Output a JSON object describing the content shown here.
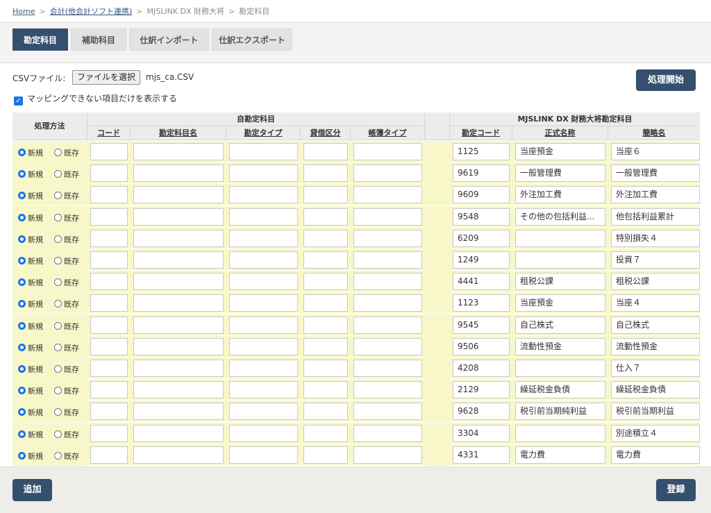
{
  "breadcrumb": {
    "home": "Home",
    "accounting": "会計(他会計ソフト連携)",
    "product": "MJSLINK DX 財務大将",
    "current": "勘定科目"
  },
  "tabs": [
    {
      "label": "勘定科目",
      "active": true
    },
    {
      "label": "補助科目",
      "active": false
    },
    {
      "label": "仕訳インポート",
      "active": false
    },
    {
      "label": "仕訳エクスポート",
      "active": false
    }
  ],
  "csv": {
    "label": "CSVファイル:",
    "choose_button": "ファイルを選択",
    "file_name": "mjs_ca.CSV"
  },
  "start_button": "処理開始",
  "filter_checkbox": {
    "label": "マッピングできない項目だけを表示する",
    "checked": true
  },
  "table": {
    "method_header": "処理方法",
    "own_group_header": "自勘定科目",
    "own_columns": [
      "コード",
      "勘定科目名",
      "勘定タイプ",
      "貸借区分",
      "帳簿タイプ"
    ],
    "mjs_group_header": "MJSLINK DX 財務大将勘定科目",
    "mjs_columns": [
      "勘定コード",
      "正式名称",
      "簡略名"
    ],
    "radio_new": "新規",
    "radio_existing": "既存",
    "rows": [
      {
        "method": "new",
        "code": "1125",
        "formal": "当座預金",
        "short": "当座６"
      },
      {
        "method": "new",
        "code": "9619",
        "formal": "一般管理費",
        "short": "一般管理費"
      },
      {
        "method": "new",
        "code": "9609",
        "formal": "外注加工費",
        "short": "外注加工費"
      },
      {
        "method": "new",
        "code": "9548",
        "formal": "その他の包括利益...",
        "short": "他包括利益累計"
      },
      {
        "method": "new",
        "code": "6209",
        "formal": "",
        "short": "特別損失４"
      },
      {
        "method": "new",
        "code": "1249",
        "formal": "",
        "short": "投資７"
      },
      {
        "method": "new",
        "code": "4441",
        "formal": "租税公課",
        "short": "租税公課"
      },
      {
        "method": "new",
        "code": "1123",
        "formal": "当座預金",
        "short": "当座４"
      },
      {
        "method": "new",
        "code": "9545",
        "formal": "自己株式",
        "short": "自己株式"
      },
      {
        "method": "new",
        "code": "9506",
        "formal": "流動性預金",
        "short": "流動性預金"
      },
      {
        "method": "new",
        "code": "4208",
        "formal": "",
        "short": "仕入７"
      },
      {
        "method": "new",
        "code": "2129",
        "formal": "繰延税金負債",
        "short": "繰延税金負債"
      },
      {
        "method": "new",
        "code": "9628",
        "formal": "税引前当期純利益",
        "short": "税引前当期利益"
      },
      {
        "method": "new",
        "code": "3304",
        "formal": "",
        "short": "別途積立４"
      },
      {
        "method": "new",
        "code": "4331",
        "formal": "電力費",
        "short": "電力費"
      }
    ]
  },
  "footer": {
    "add_button": "追加",
    "register_button": "登録"
  }
}
